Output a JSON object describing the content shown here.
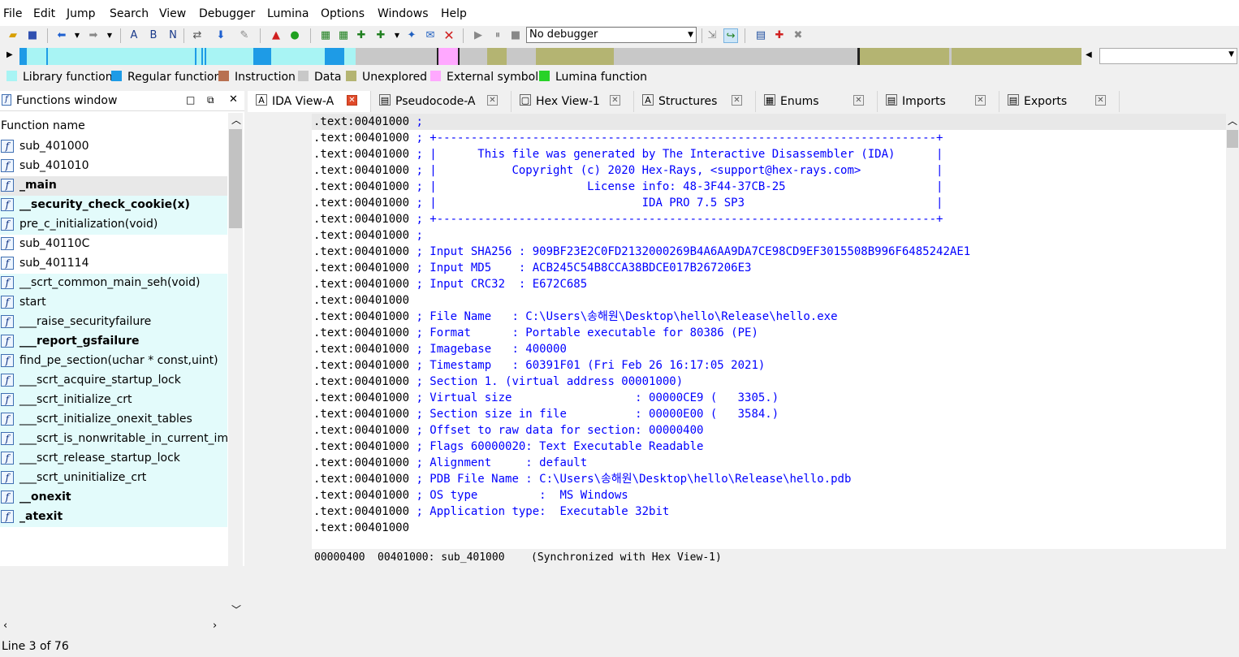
{
  "menu": [
    "File",
    "Edit",
    "Jump",
    "Search",
    "View",
    "Debugger",
    "Lumina",
    "Options",
    "Windows",
    "Help"
  ],
  "toolbar": {
    "debugger_select": "No debugger",
    "icons": [
      "open-file-icon",
      "save-icon",
      "back-icon",
      "forward-icon",
      "search-text-icon",
      "search-binary-icon",
      "search-next-icon",
      "jump-icon",
      "down-arrow-icon",
      "breakpoint-icon",
      "pause-icon",
      "green-circle-icon",
      "add-structure-icon",
      "add-enum-icon",
      "xref-icon",
      "graph-icon",
      "patch-icon",
      "cross-red-icon",
      "play-icon",
      "stop-pause-icon",
      "stop-icon",
      "attach-icon",
      "step-icon",
      "script-icon",
      "plugin-icon",
      "trash-icon"
    ]
  },
  "legend": [
    {
      "label": "Library function",
      "color": "#a8f4f4"
    },
    {
      "label": "Regular function",
      "color": "#1e9be6"
    },
    {
      "label": "Instruction",
      "color": "#b87050"
    },
    {
      "label": "Data",
      "color": "#c8c8c8"
    },
    {
      "label": "Unexplored",
      "color": "#b4b472"
    },
    {
      "label": "External symbol",
      "color": "#ffa8ff"
    },
    {
      "label": "Lumina function",
      "color": "#28d228"
    }
  ],
  "functions_window": {
    "title": "Functions window",
    "column": "Function name",
    "status": "Line 3 of 76",
    "items": [
      {
        "name": "sub_401000",
        "bold": false,
        "lib": false
      },
      {
        "name": "sub_401010",
        "bold": false,
        "lib": false
      },
      {
        "name": "_main",
        "bold": true,
        "lib": false,
        "selected": true
      },
      {
        "name": "__security_check_cookie(x)",
        "bold": true,
        "lib": true
      },
      {
        "name": "pre_c_initialization(void)",
        "bold": false,
        "lib": true
      },
      {
        "name": "sub_40110C",
        "bold": false,
        "lib": false
      },
      {
        "name": "sub_401114",
        "bold": false,
        "lib": false
      },
      {
        "name": "__scrt_common_main_seh(void)",
        "bold": false,
        "lib": true
      },
      {
        "name": "start",
        "bold": false,
        "lib": true
      },
      {
        "name": "___raise_securityfailure",
        "bold": false,
        "lib": true
      },
      {
        "name": "___report_gsfailure",
        "bold": true,
        "lib": true
      },
      {
        "name": "find_pe_section(uchar * const,uint)",
        "bold": false,
        "lib": true
      },
      {
        "name": "___scrt_acquire_startup_lock",
        "bold": false,
        "lib": true
      },
      {
        "name": "___scrt_initialize_crt",
        "bold": false,
        "lib": true
      },
      {
        "name": "___scrt_initialize_onexit_tables",
        "bold": false,
        "lib": true
      },
      {
        "name": "___scrt_is_nonwritable_in_current_imag",
        "bold": false,
        "lib": true
      },
      {
        "name": "___scrt_release_startup_lock",
        "bold": false,
        "lib": true
      },
      {
        "name": "___scrt_uninitialize_crt",
        "bold": false,
        "lib": true
      },
      {
        "name": "__onexit",
        "bold": true,
        "lib": true
      },
      {
        "name": "_atexit",
        "bold": true,
        "lib": true
      }
    ]
  },
  "tabs": [
    {
      "label": "IDA View-A",
      "icon": "ida-view-icon",
      "active": true
    },
    {
      "label": "Pseudocode-A",
      "icon": "pseudocode-icon",
      "active": false
    },
    {
      "label": "Hex View-1",
      "icon": "hex-view-icon",
      "active": false
    },
    {
      "label": "Structures",
      "icon": "structures-icon",
      "active": false
    },
    {
      "label": "Enums",
      "icon": "enums-icon",
      "active": false
    },
    {
      "label": "Imports",
      "icon": "imports-icon",
      "active": false
    },
    {
      "label": "Exports",
      "icon": "exports-icon",
      "active": false
    }
  ],
  "disasm": {
    "lines": [
      {
        "addr": ".text:00401000",
        "text": " ;"
      },
      {
        "addr": ".text:00401000",
        "text": " ; +-------------------------------------------------------------------------+"
      },
      {
        "addr": ".text:00401000",
        "text": " ; |      This file was generated by The Interactive Disassembler (IDA)      |"
      },
      {
        "addr": ".text:00401000",
        "text": " ; |           Copyright (c) 2020 Hex-Rays, <support@hex-rays.com>           |"
      },
      {
        "addr": ".text:00401000",
        "text": " ; |                      License info: 48-3F44-37CB-25                      |"
      },
      {
        "addr": ".text:00401000",
        "text": " ; |                              IDA PRO 7.5 SP3                            |"
      },
      {
        "addr": ".text:00401000",
        "text": " ; +-------------------------------------------------------------------------+"
      },
      {
        "addr": ".text:00401000",
        "text": " ;"
      },
      {
        "addr": ".text:00401000",
        "text": " ; Input SHA256 : 909BF23E2C0FD2132000269B4A6AA9DA7CE98CD9EF3015508B996F6485242AE1"
      },
      {
        "addr": ".text:00401000",
        "text": " ; Input MD5    : ACB245C54B8CCA38BDCE017B267206E3"
      },
      {
        "addr": ".text:00401000",
        "text": " ; Input CRC32  : E672C685"
      },
      {
        "addr": ".text:00401000",
        "text": ""
      },
      {
        "addr": ".text:00401000",
        "text": " ; File Name   : C:\\Users\\송해원\\Desktop\\hello\\Release\\hello.exe"
      },
      {
        "addr": ".text:00401000",
        "text": " ; Format      : Portable executable for 80386 (PE)"
      },
      {
        "addr": ".text:00401000",
        "text": " ; Imagebase   : 400000"
      },
      {
        "addr": ".text:00401000",
        "text": " ; Timestamp   : 60391F01 (Fri Feb 26 16:17:05 2021)"
      },
      {
        "addr": ".text:00401000",
        "text": " ; Section 1. (virtual address 00001000)"
      },
      {
        "addr": ".text:00401000",
        "text": " ; Virtual size                  : 00000CE9 (   3305.)"
      },
      {
        "addr": ".text:00401000",
        "text": " ; Section size in file          : 00000E00 (   3584.)"
      },
      {
        "addr": ".text:00401000",
        "text": " ; Offset to raw data for section: 00000400"
      },
      {
        "addr": ".text:00401000",
        "text": " ; Flags 60000020: Text Executable Readable"
      },
      {
        "addr": ".text:00401000",
        "text": " ; Alignment     : default"
      },
      {
        "addr": ".text:00401000",
        "text": " ; PDB File Name : C:\\Users\\송해원\\Desktop\\hello\\Release\\hello.pdb"
      },
      {
        "addr": ".text:00401000",
        "text": " ; OS type         :  MS Windows"
      },
      {
        "addr": ".text:00401000",
        "text": " ; Application type:  Executable 32bit"
      },
      {
        "addr": ".text:00401000",
        "text": ""
      }
    ]
  },
  "status": {
    "offset": "00000400",
    "location": "00401000: sub_401000",
    "sync": "(Synchronized with Hex View-1)"
  }
}
